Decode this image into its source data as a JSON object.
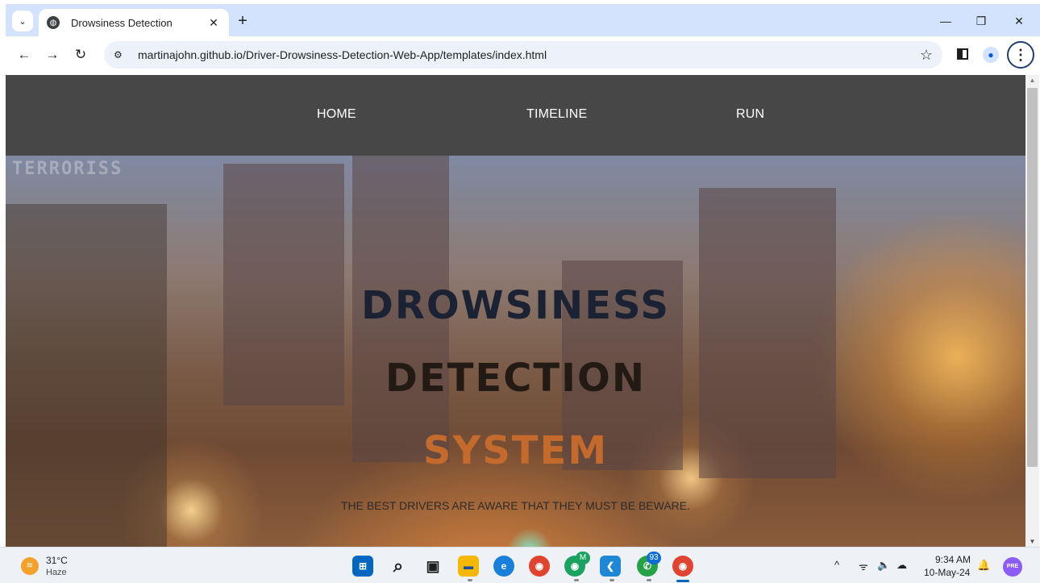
{
  "browser": {
    "tab": {
      "title": "Drowsiness Detection",
      "close_glyph": "✕"
    },
    "tab_search_glyph": "⌄",
    "new_tab_glyph": "+",
    "window": {
      "minimize": "—",
      "restore": "❐",
      "close": "✕"
    },
    "nav": {
      "back": "←",
      "forward": "→",
      "reload": "↻"
    },
    "url": "martinajohn.github.io/Driver-Drowsiness-Detection-Web-App/templates/index.html",
    "site_info_glyph": "⚙",
    "bookmark_glyph": "☆",
    "menu_glyph": "⋮"
  },
  "site": {
    "nav": [
      {
        "label": "HOME"
      },
      {
        "label": "TIMELINE"
      },
      {
        "label": "RUN"
      }
    ],
    "hero": {
      "watermark": "TERRORISS",
      "line1": "DROWSINESS",
      "line2": "DETECTION",
      "line3": "SYSTEM",
      "tagline": "THE BEST DRIVERS ARE AWARE THAT THEY MUST BE BEWARE."
    }
  },
  "taskbar": {
    "weather": {
      "temp": "31°C",
      "condition": "Haze"
    },
    "apps": [
      {
        "name": "start",
        "glyph": "⊞",
        "color": "#0067c0"
      },
      {
        "name": "search",
        "glyph": "⌕",
        "color": "#1f1f1f"
      },
      {
        "name": "task-view",
        "glyph": "▣",
        "color": "#1f1f1f"
      },
      {
        "name": "file-explorer",
        "glyph": "▬",
        "color": "#f5b800"
      },
      {
        "name": "edge",
        "glyph": "e",
        "color": "#1a7fd8"
      },
      {
        "name": "chrome",
        "glyph": "◉",
        "color": "#e0432f"
      },
      {
        "name": "chrome-profile",
        "glyph": "◉",
        "color": "#1aa260"
      },
      {
        "name": "vscode",
        "glyph": "❮",
        "color": "#1e88d6"
      },
      {
        "name": "whatsapp",
        "glyph": "✆",
        "color": "#25a244"
      },
      {
        "name": "chrome-active",
        "glyph": "◉",
        "color": "#e0432f"
      }
    ],
    "badges": {
      "whatsapp": "93",
      "chrome_profile": "M"
    },
    "tray": {
      "chevron": "^",
      "wifi": "ᯤ",
      "volume": "🔈",
      "onedrive": "☁"
    },
    "clock": {
      "time": "9:34 AM",
      "date": "10-May-24"
    },
    "notification_glyph": "🔔",
    "copilot_badge": "PRE"
  },
  "colors": {
    "tab_strip": "#d3e3fd",
    "nav_bar": "#474747",
    "accent": "#0067c0"
  }
}
